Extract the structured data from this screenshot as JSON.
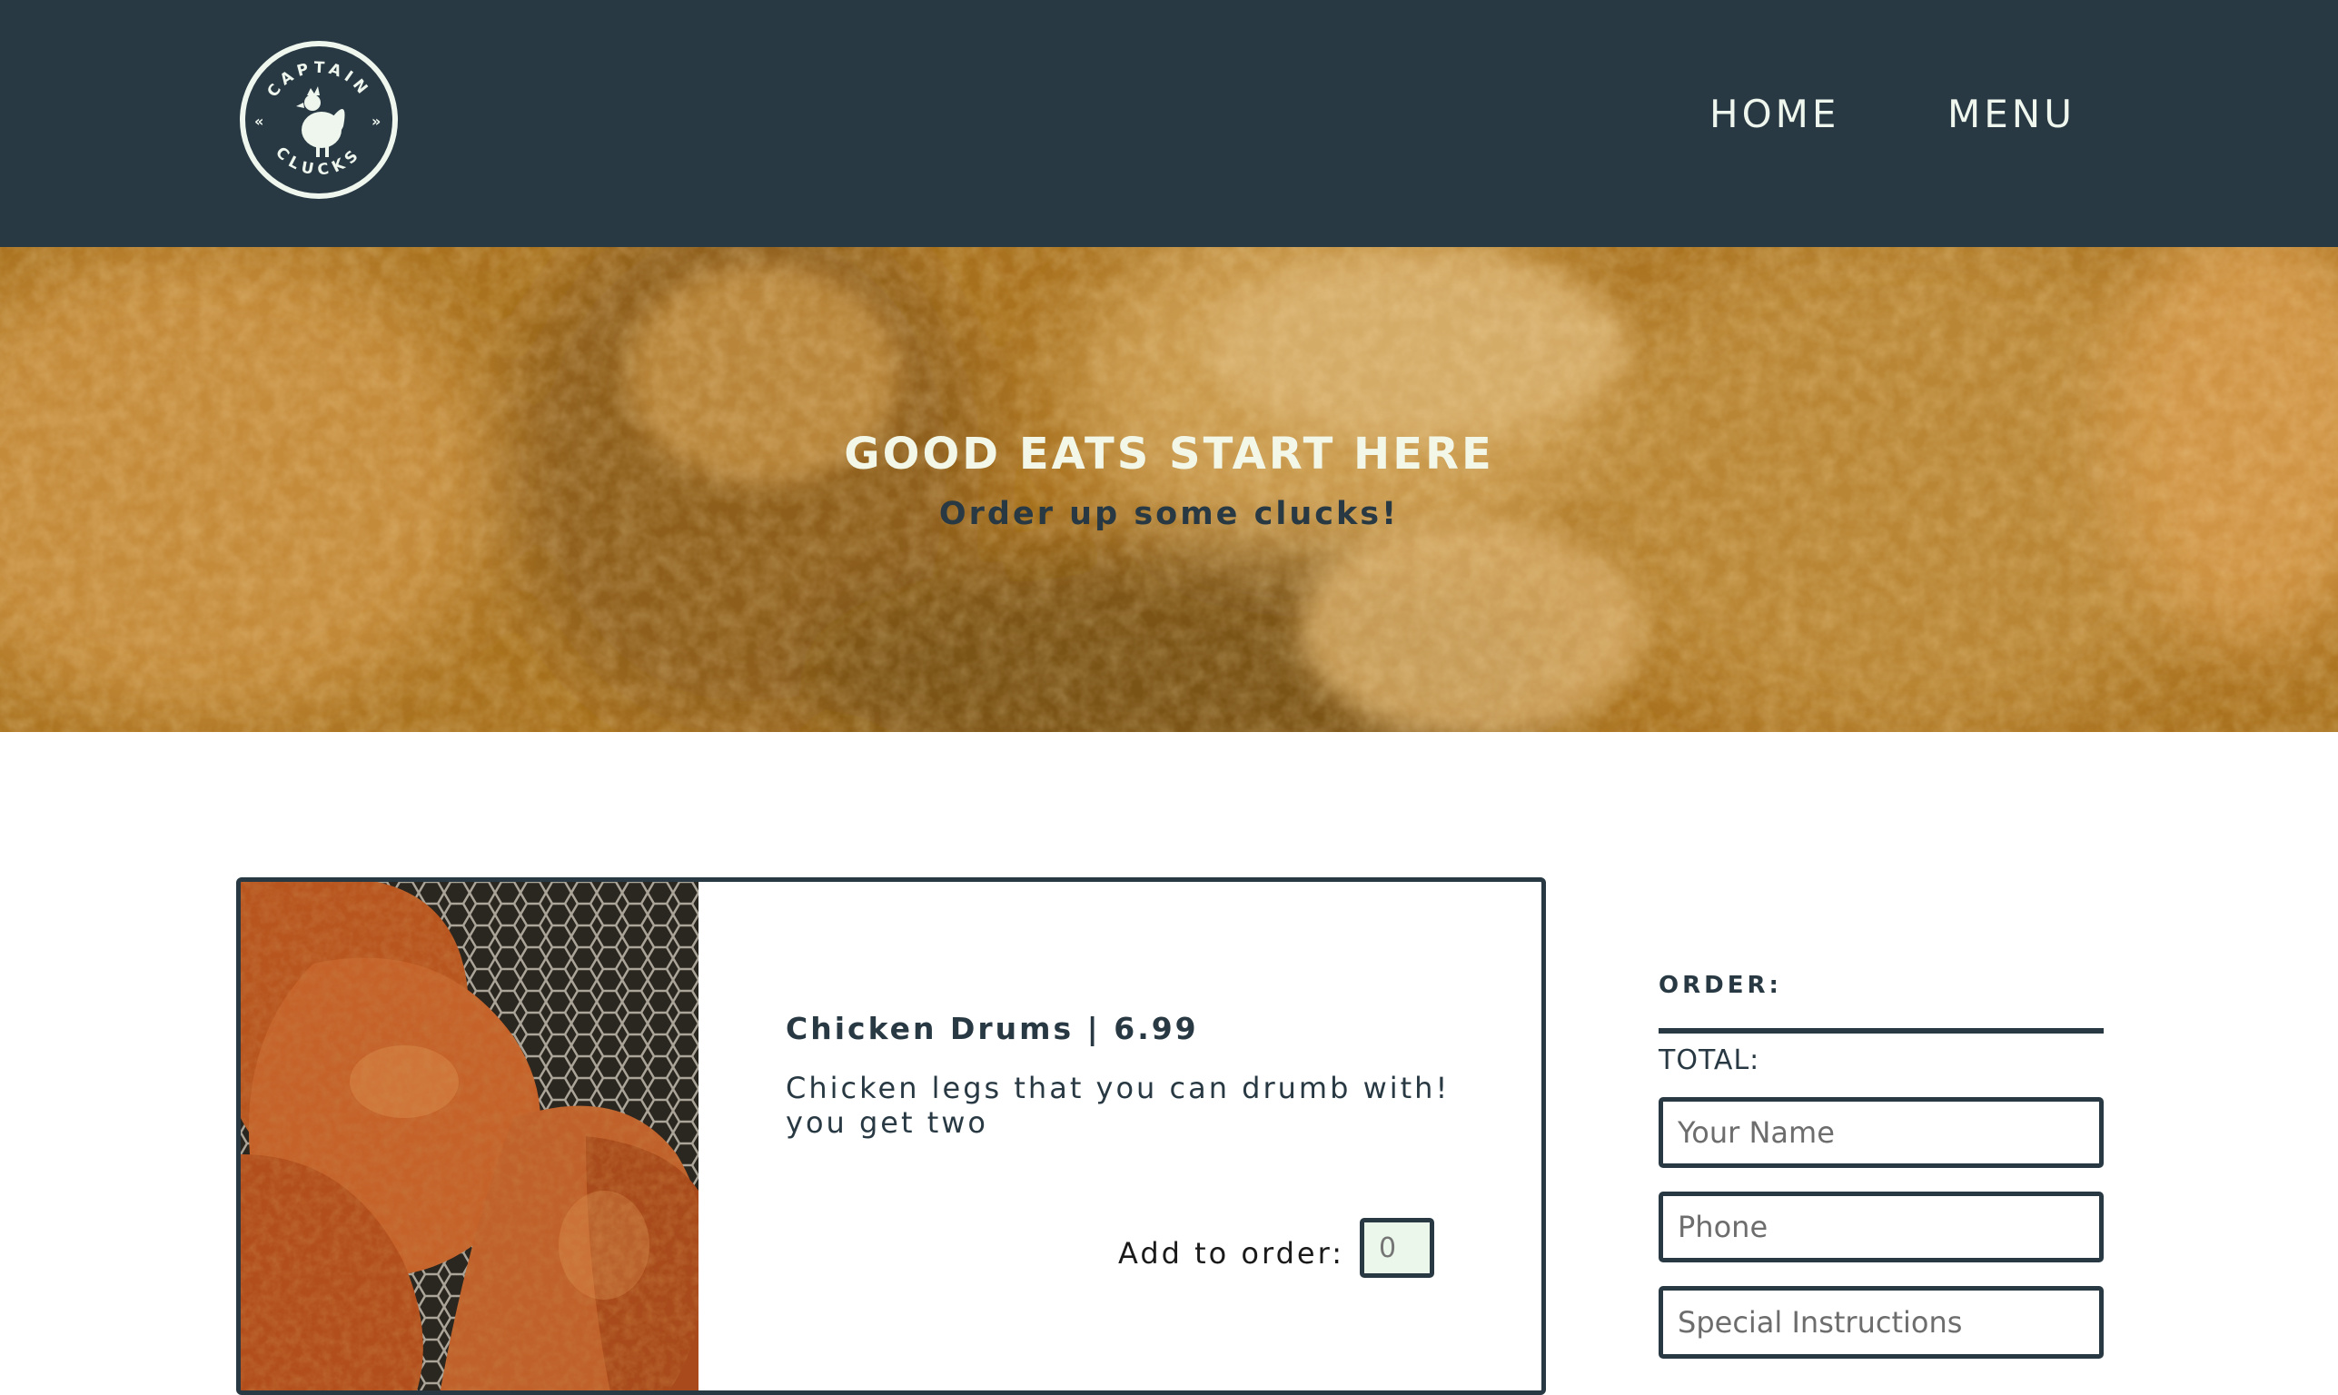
{
  "header": {
    "logo_text": "CAPTAIN CLUCKS",
    "nav": [
      {
        "label": "HOME"
      },
      {
        "label": "MENU"
      }
    ]
  },
  "hero": {
    "title": "GOOD EATS START HERE",
    "subtitle": "Order up some clucks!"
  },
  "menu_item": {
    "title": "Chicken Drums | 6.99",
    "description": "Chicken legs that you can drumb with! you get two",
    "add_label": "Add to order:",
    "quantity_placeholder": "0"
  },
  "order": {
    "heading": "ORDER:",
    "total_label": "TOTAL:",
    "name_placeholder": "Your Name",
    "phone_placeholder": "Phone",
    "instructions_placeholder": "Special Instructions"
  },
  "colors": {
    "header_bg": "#283943",
    "accent_light": "#eef6ee",
    "hero_tone": "#b17a26"
  }
}
